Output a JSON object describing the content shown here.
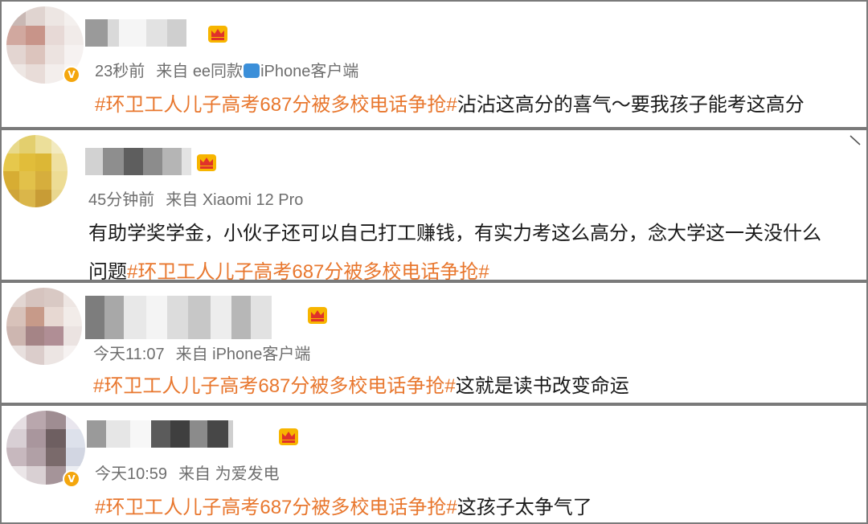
{
  "posts": [
    {
      "time": "23秒前",
      "source_prefix": "来自",
      "source_a": "ee同款",
      "source_b": "iPhone客户端",
      "hashtag": "#环卫工人儿子高考687分被多校电话争抢#",
      "text": "沾沾这高分的喜气～要我孩子能考这高分"
    },
    {
      "time": "45分钟前",
      "source_prefix": "来自",
      "source": "Xiaomi 12 Pro",
      "text_line1": "有助学奖学金，小伙子还可以自己打工赚钱，有实力考这么高分，念大学这一关没什么",
      "text_line2_prefix": "问题",
      "hashtag": "#环卫工人儿子高考687分被多校电话争抢#"
    },
    {
      "time": "今天11:07",
      "source_prefix": "来自",
      "source": "iPhone客户端",
      "hashtag": "#环卫工人儿子高考687分被多校电话争抢#",
      "text": "这就是读书改变命运"
    },
    {
      "time": "今天10:59",
      "source_prefix": "来自",
      "source": "为爱发电",
      "hashtag": "#环卫工人儿子高考687分被多校电话争抢#",
      "text": "这孩子太争气了"
    }
  ],
  "icons": {
    "verified": "verified-v-icon",
    "crown": "vip-crown-icon",
    "collapse": "chevron-collapse-icon"
  },
  "colors": {
    "hashtag": "#e8772e",
    "meta": "#6e6e6e",
    "verified": "#f4a60d"
  }
}
